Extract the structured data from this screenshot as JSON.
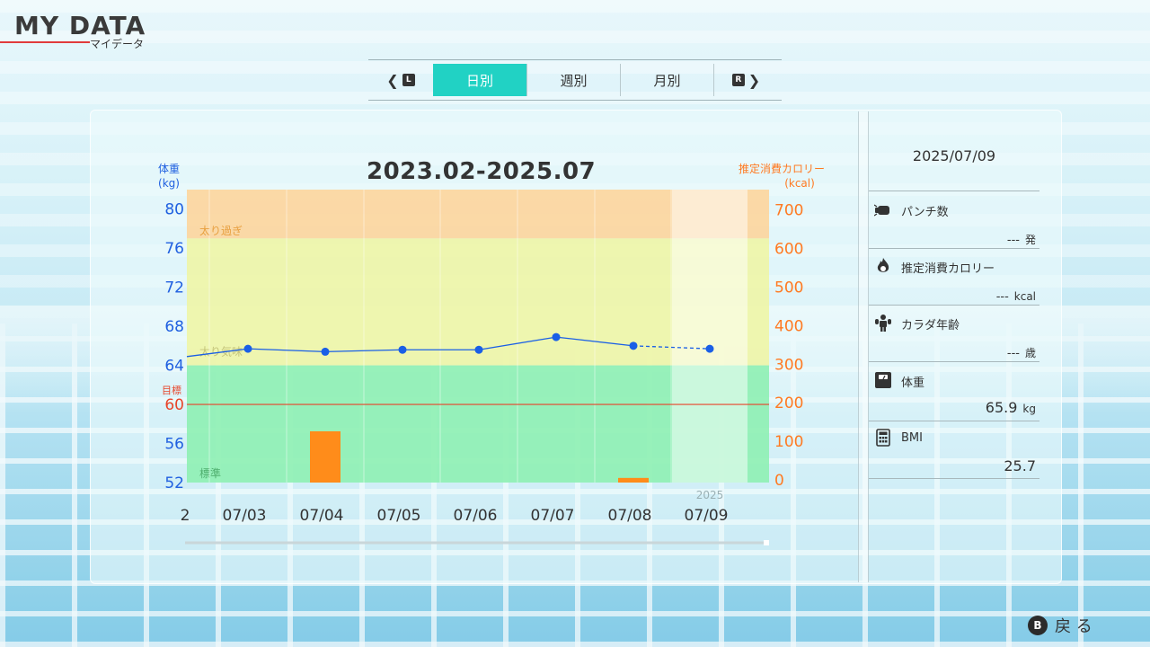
{
  "header": {
    "title": "MY DATA",
    "subtitle": "マイデータ"
  },
  "tabs": {
    "prev_key": "L",
    "next_key": "R",
    "items": [
      {
        "label": "日別",
        "active": true
      },
      {
        "label": "週別",
        "active": false
      },
      {
        "label": "月別",
        "active": false
      }
    ]
  },
  "chart_data": {
    "type": "line",
    "title": "2023.02-2025.07",
    "left_axis": {
      "label": "体重",
      "unit": "(kg)",
      "ticks": [
        52,
        56,
        60,
        64,
        68,
        72,
        76,
        80
      ],
      "range": [
        52,
        82
      ]
    },
    "right_axis": {
      "label": "推定消費カロリー",
      "unit": "(kcal)",
      "ticks": [
        0,
        100,
        200,
        300,
        400,
        500,
        600,
        700
      ],
      "range": [
        0,
        760
      ]
    },
    "zones": [
      {
        "label": "太り過ぎ",
        "from": 77,
        "to": 82,
        "color": "#fdd59c"
      },
      {
        "label": "太り気味",
        "from": 64,
        "to": 77,
        "color": "#eef5a6"
      },
      {
        "label": "標準",
        "from": 52,
        "to": 64,
        "color": "#8ef0b2"
      }
    ],
    "target": {
      "label": "目標",
      "value": 60
    },
    "categories": [
      "2",
      "07/03",
      "07/04",
      "07/05",
      "07/06",
      "07/07",
      "07/08",
      "07/09"
    ],
    "year_label": "2025",
    "series": [
      {
        "name": "体重",
        "color": "#1a5fe6",
        "values": [
          64.9,
          65.7,
          65.4,
          65.6,
          65.6,
          66.9,
          66.0,
          65.7
        ]
      },
      {
        "name": "推定消費カロリー",
        "color": "#ff8c1a",
        "values": [
          0,
          0,
          133,
          0,
          0,
          0,
          12,
          0
        ]
      }
    ]
  },
  "side": {
    "date": "2025/07/09",
    "items": [
      {
        "label": "パンチ数",
        "value": "---",
        "unit": "発",
        "icon": "punch-icon"
      },
      {
        "label": "推定消費カロリー",
        "value": "---",
        "unit": "kcal",
        "icon": "flame-icon"
      },
      {
        "label": "カラダ年齢",
        "value": "---",
        "unit": "歳",
        "icon": "body-icon"
      },
      {
        "label": "体重",
        "value": "65.9",
        "unit": "kg",
        "icon": "scale-icon"
      },
      {
        "label": "BMI",
        "value": "25.7",
        "unit": "",
        "icon": "calculator-icon"
      }
    ]
  },
  "footer": {
    "back_key": "B",
    "back_label": "戻 る"
  }
}
